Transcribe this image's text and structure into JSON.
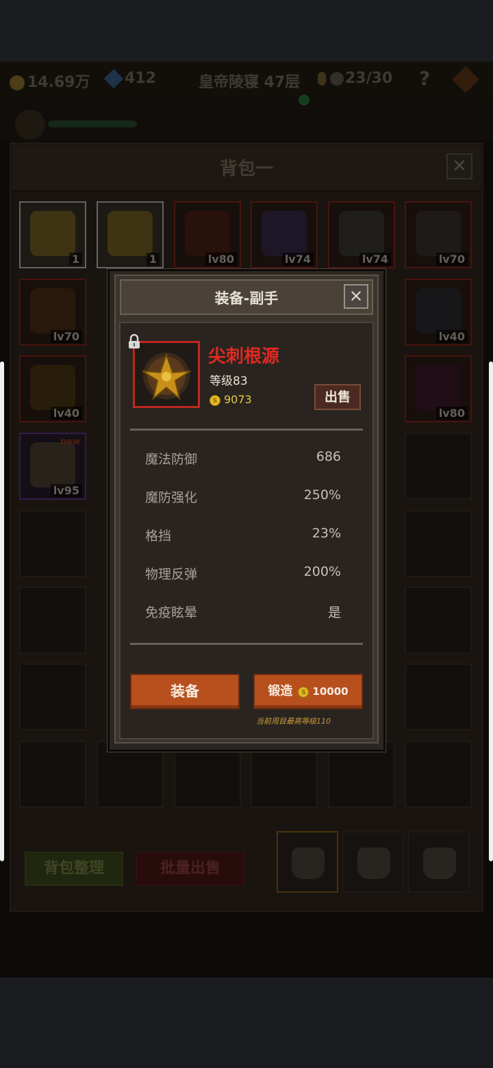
{
  "hud": {
    "gold": "14.69万",
    "gems": "412",
    "floor": "皇帝陵寝 47层",
    "keys": "23/30",
    "help": "?"
  },
  "bag": {
    "title": "背包一",
    "close": "✕",
    "slots_row1": [
      {
        "label": "1",
        "rarity": "white"
      },
      {
        "label": "1",
        "rarity": "white"
      },
      {
        "label": "lv80",
        "rarity": "red"
      },
      {
        "label": "lv74",
        "rarity": "red"
      },
      {
        "label": "lv74",
        "rarity": "red"
      },
      {
        "label": "lv70",
        "rarity": "red"
      }
    ],
    "row2_left": "lv70",
    "row2_right": "lv40",
    "row3_left": "lv40",
    "row3_right": "lv80",
    "row4_left": "lv95",
    "new_tag": "new",
    "sort_button": "背包整理",
    "bulk_sell_button": "批量出售"
  },
  "modal": {
    "title": "装备-副手",
    "close": "✕",
    "item": {
      "name": "尖刺根源",
      "level": "等级83",
      "price": "9073",
      "coin_glyph": "S"
    },
    "sell_button": "出售",
    "stats": [
      {
        "name": "魔法防御",
        "value": "686"
      },
      {
        "name": "魔防强化",
        "value": "250%"
      },
      {
        "name": "格挡",
        "value": "23%"
      },
      {
        "name": "物理反弹",
        "value": "200%"
      },
      {
        "name": "免疫眩晕",
        "value": "是"
      }
    ],
    "equip_button": "装备",
    "forge_button": "锻造",
    "forge_cost": "10000",
    "max_level_note": "当前周目最高等级110"
  },
  "colors": {
    "item_name": "#e02a20",
    "button_orange": "#b8501e",
    "gold": "#e8c84a"
  }
}
